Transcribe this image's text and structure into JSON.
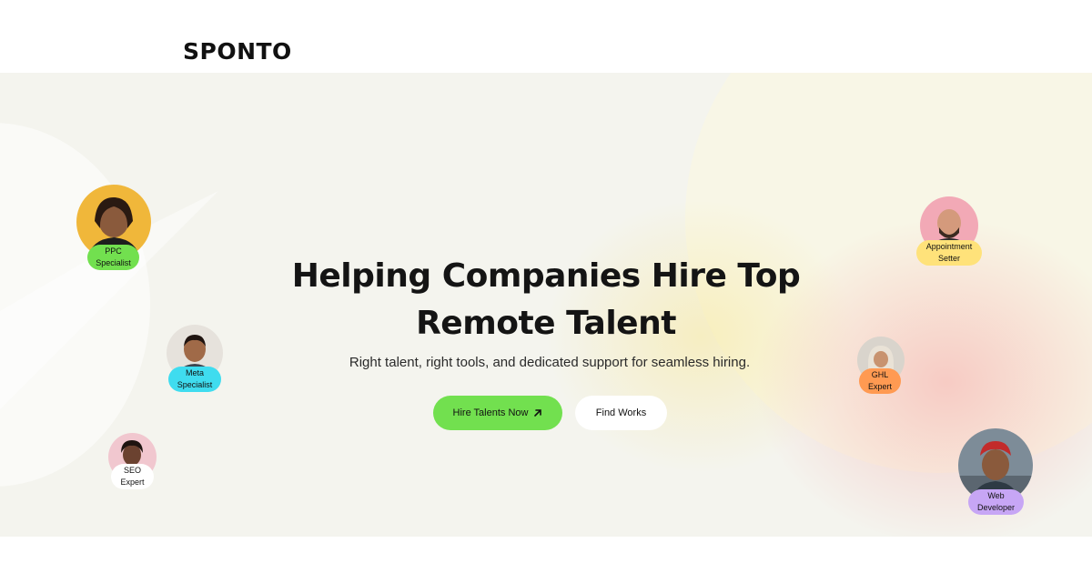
{
  "header": {
    "logo_text": "SPONTO"
  },
  "hero": {
    "headline_line1": "Helping Companies Hire Top",
    "headline_line2": "Remote Talent",
    "subtitle": "Right talent, right tools, and dedicated support for seamless hiring.",
    "primary_button_label": "Hire Talents Now",
    "primary_button_icon": "arrow-up-right-icon",
    "secondary_button_label": "Find Works"
  },
  "talents": [
    {
      "line1": "PPC",
      "line2": "Specialist",
      "color": "#72e04f"
    },
    {
      "line1": "Meta",
      "line2": "Specialist",
      "color": "#3fdcef"
    },
    {
      "line1": "SEO",
      "line2": "Expert",
      "color": "#ffffff"
    },
    {
      "line1": "Appointment",
      "line2": "Setter",
      "color": "#ffe27a"
    },
    {
      "line1": "GHL",
      "line2": "Expert",
      "color": "#ff9a52"
    },
    {
      "line1": "Web",
      "line2": "Developer",
      "color": "#c7a6f5"
    }
  ],
  "colors": {
    "accent_green": "#72e04f",
    "text_dark": "#141414"
  }
}
